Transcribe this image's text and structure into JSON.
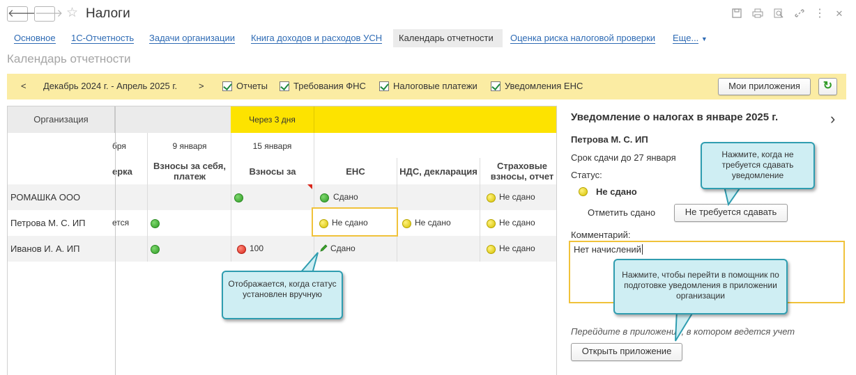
{
  "header": {
    "title": "Налоги",
    "back_glyph": "🡐",
    "forward_glyph": "🡒",
    "star_glyph": "☆",
    "more_glyph": "⋮",
    "close_glyph": "✕"
  },
  "tabs": [
    {
      "label": "Основное"
    },
    {
      "label": "1С-Отчетность"
    },
    {
      "label": "Задачи организации"
    },
    {
      "label": "Книга доходов и расходов УСН"
    },
    {
      "label": "Календарь отчетности"
    },
    {
      "label": "Оценка риска налоговой проверки"
    },
    {
      "label": "Еще..."
    }
  ],
  "subtitle": "Календарь отчетности",
  "toolbar": {
    "prev": "<",
    "period": "Декабрь 2024 г. - Апрель 2025 г.",
    "next": ">",
    "filters": [
      {
        "label": "Отчеты",
        "checked": true
      },
      {
        "label": "Требования ФНС",
        "checked": true
      },
      {
        "label": "Налоговые платежи",
        "checked": true
      },
      {
        "label": "Уведомления ЕНС",
        "checked": true
      }
    ],
    "my_apps": "Мои приложения",
    "refresh_glyph": "↻"
  },
  "grid": {
    "org_header": "Организация",
    "soon_label": "Через 3 дня",
    "dates": [
      "бря",
      "9 января",
      "15 января"
    ],
    "columns": [
      "ерка",
      "Взносы за себя, платеж",
      "Взносы за",
      "ЕНС",
      "НДС, декларация",
      "Страховые взносы, отчет"
    ],
    "rows": [
      {
        "org": "РОМАШКА ООО",
        "c0": "",
        "c1": "",
        "c2": "",
        "c3": "Сдано",
        "c4": "",
        "c5": "Не сдано"
      },
      {
        "org": "Петрова М. С. ИП",
        "c0": "ется",
        "c1": "",
        "c2": "",
        "c3": "Не сдано",
        "c4": "Не сдано",
        "c5": "Не сдано"
      },
      {
        "org": "Иванов И. А. ИП",
        "c0": "",
        "c1": "",
        "c2": "100",
        "c3": "Сдано",
        "c4": "",
        "c5": "Не сдано"
      }
    ]
  },
  "callouts": {
    "manual": "Отображается, когда статус установлен вручную",
    "not_required": "Нажмите, когда не требуется сдавать уведомление",
    "open_app": "Нажмите, чтобы перейти в помощник по подготовке уведомления в приложении организации"
  },
  "panel": {
    "title": "Уведомление о налогах в январе 2025 г.",
    "arrow": "›",
    "org": "Петрова М. С. ИП",
    "due": "Срок сдачи до 27 января",
    "status_label": "Статус:",
    "status_value": "Не сдано",
    "mark_label": "Отметить сдано",
    "not_required_btn": "Не требуется сдавать",
    "comment_label": "Комментарий:",
    "comment_value": "Нет начислений",
    "hint": "Перейдите в приложение, в котором ведется учет",
    "open_btn": "Открыть приложение"
  },
  "colors": {
    "accent_yellow": "#fde300",
    "toolbar_bg": "#fbeca3",
    "link": "#2d6ab4",
    "callout_border": "#2f9db0",
    "selection": "#f0c23a"
  }
}
